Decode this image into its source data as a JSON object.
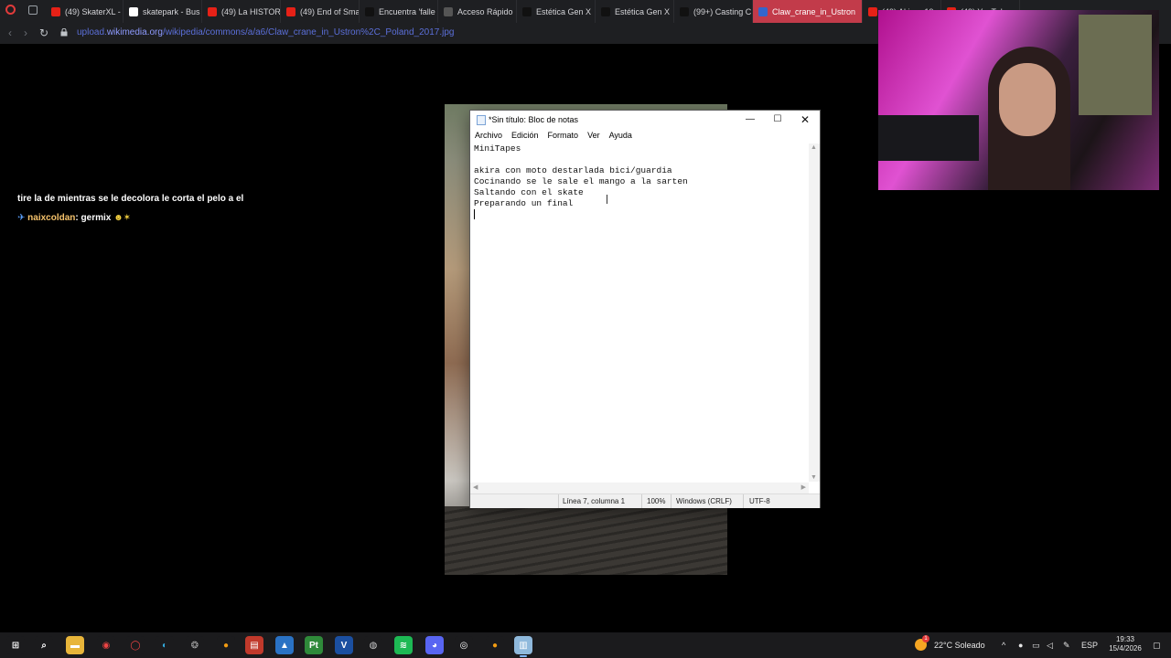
{
  "browser": {
    "tabs": [
      {
        "label": "(49) SkaterXL -",
        "icon": "youtube-icon",
        "active": false
      },
      {
        "label": "skatepark - Bus",
        "icon": "google-icon",
        "active": false
      },
      {
        "label": "(49) La HISTOR",
        "icon": "youtube-icon",
        "active": false
      },
      {
        "label": "(49) End of Sma",
        "icon": "youtube-icon",
        "active": false
      },
      {
        "label": "Encuentra 'falle",
        "icon": "tiktok-icon",
        "active": false
      },
      {
        "label": "Acceso Rápido",
        "icon": "grid-icon",
        "active": false
      },
      {
        "label": "Estética Gen X",
        "icon": "tiktok-icon",
        "active": false
      },
      {
        "label": "Estética Gen X",
        "icon": "tiktok-icon",
        "active": false
      },
      {
        "label": "(99+) Casting C",
        "icon": "tiktok-icon",
        "active": false
      },
      {
        "label": "Claw_crane_in_Ustron",
        "icon": "wikimedia-icon",
        "active": true
      },
      {
        "label": "(49) Akira - 19",
        "icon": "youtube-icon",
        "active": false
      },
      {
        "label": "(49) YouTube",
        "icon": "youtube-icon",
        "active": false
      }
    ],
    "url_prefix": "upload.",
    "url_host": "wikimedia.org",
    "url_path": "/wikipedia/commons/a/a6/Claw_crane_in_Ustron%2C_Poland_2017.jpg"
  },
  "chat": {
    "line1": "tire la de mientras se le decolora le corta el pelo a el",
    "user": "naixcoldan",
    "message": "germix"
  },
  "notepad": {
    "title": "*Sin título: Bloc de notas",
    "menu": [
      "Archivo",
      "Edición",
      "Formato",
      "Ver",
      "Ayuda"
    ],
    "lines": [
      "MiniTapes",
      "",
      "akira con moto destarlada bici/guardia",
      "Cocinando se le sale el mango a la sarten",
      "Saltando con el skate",
      "Preparando un final"
    ],
    "status": {
      "position": "Línea 7, columna 1",
      "zoom": "100%",
      "eol": "Windows (CRLF)",
      "encoding": "UTF-8"
    }
  },
  "taskbar": {
    "apps": [
      "windows-start-icon",
      "search-icon",
      "file-explorer-icon",
      "chrome-icon",
      "opera-gx-icon",
      "edge-icon",
      "network-icon",
      "app-orange-icon",
      "voicemeeter-icon",
      "photos-icon",
      "pt-app-icon",
      "v-app-icon",
      "obs-icon",
      "spotify-icon",
      "discord-icon",
      "steam-icon",
      "blender-icon",
      "notepad-icon"
    ],
    "weather_badge": "1",
    "weather": "22°C  Soleado",
    "lang": "ESP",
    "time": "19:33",
    "date": "15/4/2026"
  },
  "colors": {
    "active_tab": "#c23b4a",
    "url": "#5b6fd9",
    "chat_name": "#f5c26b"
  }
}
